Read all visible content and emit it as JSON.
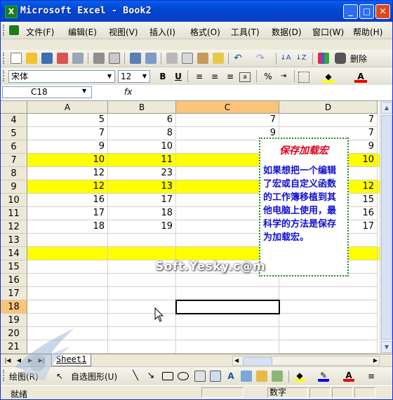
{
  "window": {
    "title": "Microsoft Excel - Book2",
    "icon": "excel-icon"
  },
  "title_buttons": {
    "minimize": "_",
    "maximize": "□",
    "close": "✕"
  },
  "menu": [
    "文件(F)",
    "编辑(E)",
    "视图(V)",
    "插入(I)",
    "格式(O)",
    "工具(T)",
    "数据(D)",
    "窗口(W)",
    "帮助(H)"
  ],
  "toolbar": {
    "delete_label": "删除"
  },
  "format_bar": {
    "font": "宋体",
    "size": "12",
    "bold": "B",
    "underline": "U",
    "percent": "%"
  },
  "formula_bar": {
    "name_box": "C18",
    "fx": "fx",
    "formula": ""
  },
  "columns": [
    "A",
    "B",
    "C",
    "D"
  ],
  "selected_column": "C",
  "rows": [
    {
      "num": "4",
      "a": "5",
      "b": "6",
      "c": "7",
      "d": "7"
    },
    {
      "num": "5",
      "a": "7",
      "b": "8",
      "c": "9",
      "d": "7"
    },
    {
      "num": "6",
      "a": "9",
      "b": "10",
      "c": "",
      "d": "9"
    },
    {
      "num": "7",
      "a": "10",
      "b": "11",
      "c": "",
      "d": "10"
    },
    {
      "num": "8",
      "a": "12",
      "b": "23",
      "c": "",
      "d": ""
    },
    {
      "num": "9",
      "a": "12",
      "b": "13",
      "c": "",
      "d": "12"
    },
    {
      "num": "10",
      "a": "16",
      "b": "17",
      "c": "",
      "d": "15"
    },
    {
      "num": "11",
      "a": "17",
      "b": "18",
      "c": "",
      "d": "16"
    },
    {
      "num": "12",
      "a": "18",
      "b": "19",
      "c": "",
      "d": "17"
    },
    {
      "num": "13",
      "a": "",
      "b": "",
      "c": "",
      "d": ""
    },
    {
      "num": "14",
      "a": "",
      "b": "",
      "c": "",
      "d": ""
    },
    {
      "num": "15",
      "a": "",
      "b": "",
      "c": "",
      "d": ""
    },
    {
      "num": "16",
      "a": "",
      "b": "",
      "c": "",
      "d": ""
    },
    {
      "num": "17",
      "a": "",
      "b": "",
      "c": "",
      "d": ""
    },
    {
      "num": "18",
      "a": "",
      "b": "",
      "c": "",
      "d": ""
    },
    {
      "num": "19",
      "a": "",
      "b": "",
      "c": "",
      "d": ""
    },
    {
      "num": "20",
      "a": "",
      "b": "",
      "c": "",
      "d": ""
    },
    {
      "num": "21",
      "a": "",
      "b": "",
      "c": "",
      "d": ""
    }
  ],
  "highlighted_rows": [
    "7",
    "9",
    "14"
  ],
  "highlight_color": "#ffff00",
  "selected_row": "18",
  "note": {
    "title": "保存加载宏",
    "body": "如果想把一个编辑了宏或自定义函数的工作簿移植到其他电脑上使用，最科学的方法是保存为加载宏。"
  },
  "watermark": "Soft.Yesky.c@m",
  "sheet_tab": "Sheet1",
  "drawing_bar": {
    "draw_label": "绘图(R)",
    "autoshape_label": "自选图形(U)"
  },
  "status": {
    "ready": "就绪",
    "num": "数字"
  }
}
